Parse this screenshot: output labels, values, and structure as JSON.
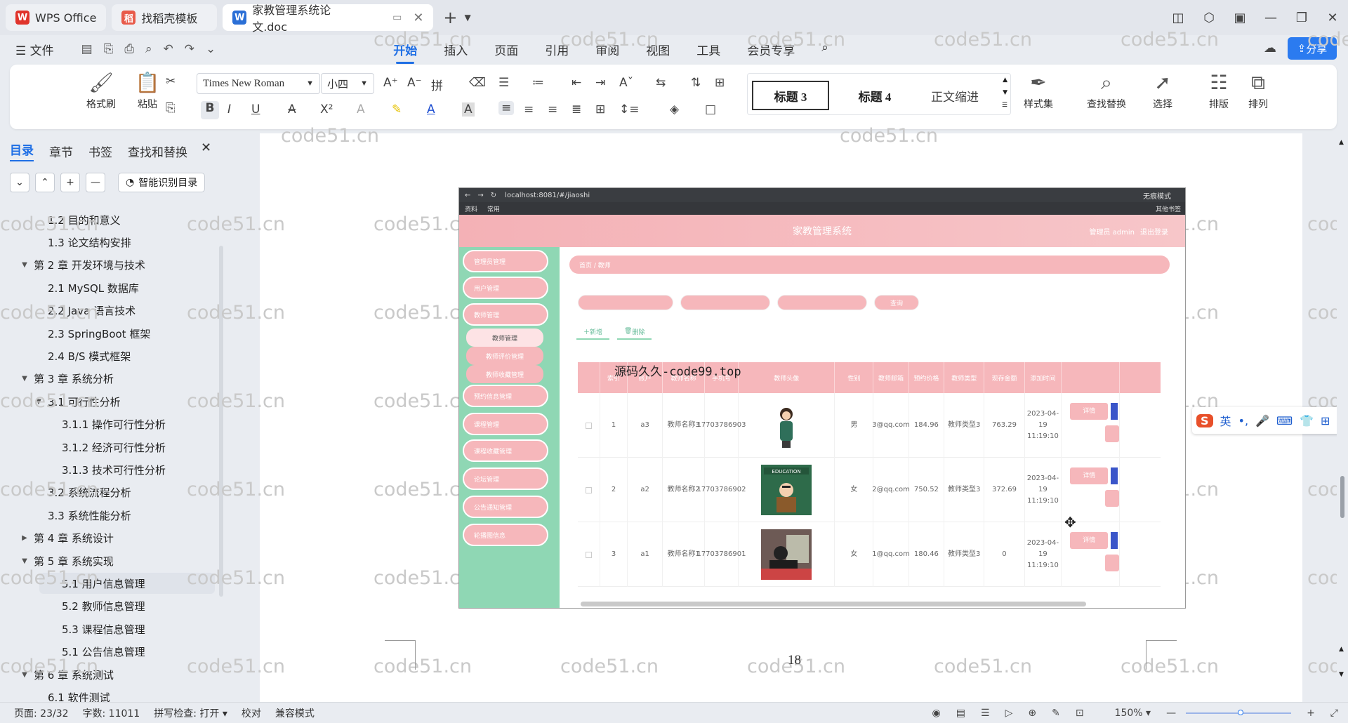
{
  "tabs": [
    {
      "label": "WPS Office",
      "icon": "wps-logo-icon"
    },
    {
      "label": "找稻壳模板",
      "icon": "docer-icon"
    },
    {
      "label": "家教管理系统论文.doc",
      "icon": "word-doc-icon"
    }
  ],
  "menu": {
    "file": "文件",
    "items": [
      "开始",
      "插入",
      "页面",
      "引用",
      "审阅",
      "视图",
      "工具",
      "会员专享"
    ],
    "share": "分享"
  },
  "ribbon": {
    "format_painter": "格式刷",
    "paste": "粘贴",
    "font_name": "Times New Roman",
    "font_size": "小四",
    "styles": [
      "标题 3",
      "标题 4",
      "正文缩进"
    ],
    "style_set": "样式集",
    "find_replace": "查找替换",
    "select": "选择",
    "layout": "排版",
    "arrange": "排列"
  },
  "nav": {
    "tabs": [
      "目录",
      "章节",
      "书签",
      "查找和替换"
    ],
    "smart_btn": "智能识别目录",
    "toc": [
      {
        "label": "1.2 目的和意义",
        "level": 2,
        "arrow": ""
      },
      {
        "label": "1.3 论文结构安排",
        "level": 2,
        "arrow": ""
      },
      {
        "label": "第 2 章  开发环境与技术",
        "level": 1,
        "arrow": "▼"
      },
      {
        "label": "2.1 MySQL 数据库",
        "level": 2,
        "arrow": ""
      },
      {
        "label": "2.2 Java 语言技术",
        "level": 2,
        "arrow": ""
      },
      {
        "label": "2.3 SpringBoot 框架",
        "level": 2,
        "arrow": ""
      },
      {
        "label": "2.4 B/S 模式框架",
        "level": 2,
        "arrow": ""
      },
      {
        "label": "第 3 章  系统分析",
        "level": 1,
        "arrow": "▼"
      },
      {
        "label": "3.1 可行性分析",
        "level": 2,
        "arrow": "▼"
      },
      {
        "label": "3.1.1 操作可行性分析",
        "level": 3,
        "arrow": ""
      },
      {
        "label": "3.1.2 经济可行性分析",
        "level": 3,
        "arrow": ""
      },
      {
        "label": "3.1.3 技术可行性分析",
        "level": 3,
        "arrow": ""
      },
      {
        "label": "3.2 系统流程分析",
        "level": 2,
        "arrow": ""
      },
      {
        "label": "3.3 系统性能分析",
        "level": 2,
        "arrow": ""
      },
      {
        "label": "第 4 章  系统设计",
        "level": 1,
        "arrow": "▶"
      },
      {
        "label": "第 5 章  系统实现",
        "level": 1,
        "arrow": "▼"
      },
      {
        "label": "5.1 用户信息管理",
        "level": 3,
        "arrow": "",
        "selected": true
      },
      {
        "label": "5.2  教师信息管理",
        "level": 3,
        "arrow": ""
      },
      {
        "label": "5.3 课程信息管理",
        "level": 3,
        "arrow": ""
      },
      {
        "label": "5.1 公告信息管理",
        "level": 3,
        "arrow": ""
      },
      {
        "label": "第 6 章  系统测试",
        "level": 1,
        "arrow": "▼"
      },
      {
        "label": "6.1 软件测试",
        "level": 2,
        "arrow": ""
      }
    ]
  },
  "doc": {
    "watermark": "code51.cn",
    "overlay_text": "源码久久-code99.top",
    "page_number": "18",
    "screenshot": {
      "url": "localhost:8081/#/jiaoshi",
      "bookmarks": [
        "资料",
        "常用",
        "其他书签"
      ],
      "incognito": "无痕模式",
      "app_title": "家教管理系统",
      "user_info": "管理员 admin",
      "logout": "退出登录",
      "breadcrumb": "首页  /  教师",
      "side_menu": [
        "管理员管理",
        "用户管理",
        "教师管理",
        "预约信息管理",
        "课程管理",
        "课程收藏管理",
        "论坛管理",
        "公告通知管理",
        "轮播图信息"
      ],
      "side_sub": [
        "教师管理",
        "教师评价管理",
        "教师收藏管理"
      ],
      "search_btn": "查询",
      "add_btn": "新增",
      "del_btn": "删除",
      "columns": [
        "",
        "索引",
        "账户",
        "教师名称",
        "手机号",
        "教师头像",
        "性别",
        "教师邮箱",
        "预约价格",
        "教师类型",
        "现存金额",
        "添加时间",
        ""
      ],
      "rows": [
        [
          "1",
          "a3",
          "教师名称3",
          "17703786903",
          "男",
          "3@qq.com",
          "184.96",
          "教师类型3",
          "763.29",
          "2023-04-19 11:19:10"
        ],
        [
          "2",
          "a2",
          "教师名称2",
          "17703786902",
          "女",
          "2@qq.com",
          "750.52",
          "教师类型3",
          "372.69",
          "2023-04-19 11:19:10"
        ],
        [
          "3",
          "a1",
          "教师名称1",
          "17703786901",
          "女",
          "1@qq.com",
          "180.46",
          "教师类型3",
          "0",
          "2023-04-19 11:19:10"
        ]
      ],
      "detail_btn": "详情"
    }
  },
  "ime": {
    "lang": "英"
  },
  "status": {
    "page": "页面: 23/32",
    "words": "字数: 11011",
    "spell": "拼写检查: 打开",
    "proof": "校对",
    "compat": "兼容模式",
    "zoom": "150%"
  },
  "colors": {
    "accent": "#1f6fe5",
    "app_pink": "#f6b7bb",
    "app_green": "#8fd7b4"
  }
}
